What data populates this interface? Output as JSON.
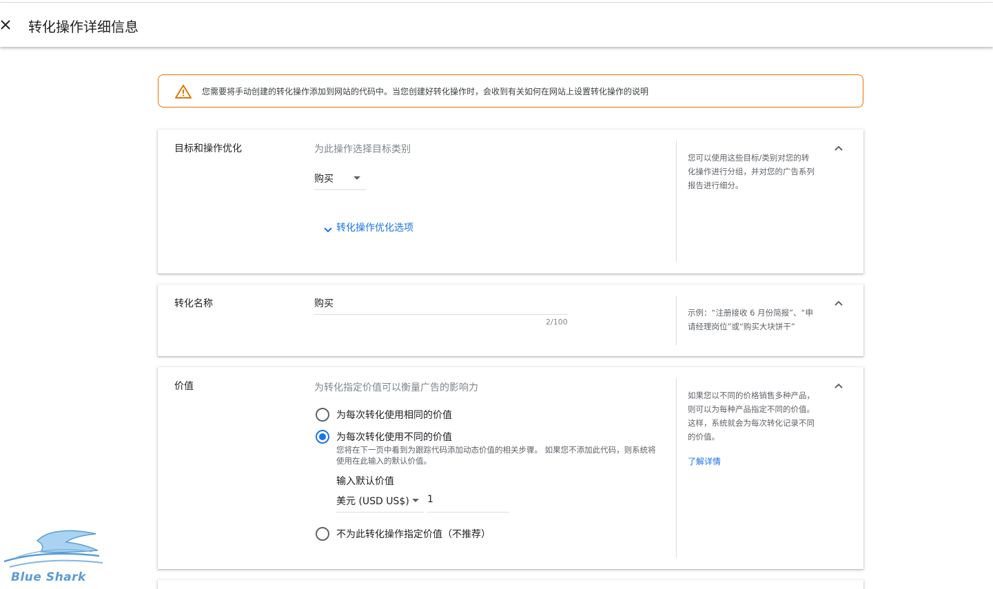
{
  "header": {
    "title": "转化操作详细信息",
    "close_icon": "close-icon"
  },
  "warning": {
    "icon": "warning-triangle-icon",
    "text": "您需要将手动创建的转化操作添加到网站的代码中。当您创建好转化操作时，会收到有关如何在网站上设置转化操作的说明"
  },
  "goal_section": {
    "label": "目标和操作优化",
    "category_hint": "为此操作选择目标类别",
    "category_value": "购买",
    "optimization_link": "转化操作优化选项",
    "help_text": "您可以使用这些目标/类别对您的转化操作进行分组，并对您的广告系列报告进行细分。"
  },
  "name_section": {
    "label": "转化名称",
    "name_value": "购买",
    "counter": "2/100",
    "help_text": "示例：“注册接收 6 月份简报”、“申请经理岗位”或“购买大块饼干”"
  },
  "value_section": {
    "label": "价值",
    "hint": "为转化指定价值可以衡量广告的影响力",
    "options": [
      {
        "label": "为每次转化使用相同的价值",
        "checked": false
      },
      {
        "label": "为每次转化使用不同的价值",
        "checked": true,
        "description": "您将在下一页中看到为跟踪代码添加动态价值的相关步骤。 如果您不添加此代码，则系统将使用在此输入的默认价值。"
      },
      {
        "label": "不为此转化操作指定价值（不推荐）",
        "checked": false
      }
    ],
    "default_value_label": "输入默认价值",
    "currency": "美元 (USD US$)",
    "amount": "1",
    "help_text": "如果您以不同的价格销售多种产品，则可以为每种产品指定不同的价值。这样，系统就会为每次转化记录不同的价值。",
    "learn_more": "了解详情"
  },
  "watermark": {
    "text": "Blue Shark"
  },
  "colors": {
    "accent": "#1a73e8",
    "warning_border": "#e37400",
    "divider": "#dadce0"
  }
}
